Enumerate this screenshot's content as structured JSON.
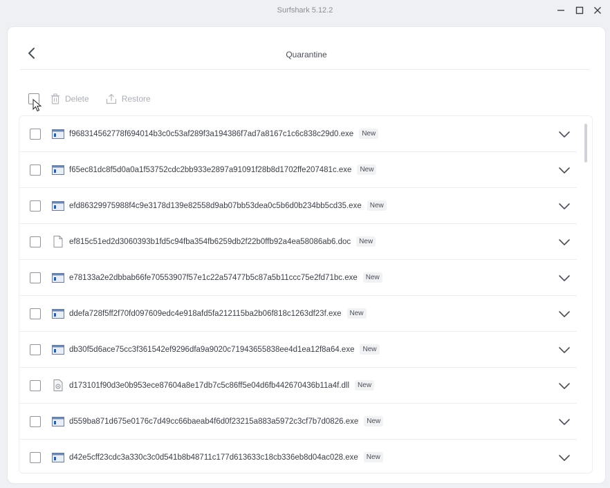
{
  "window": {
    "title": "Surfshark 5.12.2",
    "controls": [
      "minimize-icon",
      "maximize-icon",
      "close-icon"
    ]
  },
  "page": {
    "title": "Quarantine",
    "back_icon": "chevron-left-icon"
  },
  "toolbar": {
    "delete_label": "Delete",
    "delete_icon": "trash-icon",
    "restore_label": "Restore",
    "restore_icon": "upload-icon"
  },
  "files": [
    {
      "name": "f968314562778f694014b3c0c53af289f3a194386f7ad7a8167c1c6c838c29d0.exe",
      "badge": "New",
      "type": "exe"
    },
    {
      "name": "f65ec81dc8f5d0a0a1f53752cdc2bb933e2897a91091f28b8d1702ffe207481c.exe",
      "badge": "New",
      "type": "exe"
    },
    {
      "name": "efd86329975988f4c9e3178d139e82558d9ab07bb53dea0c5b6d0b234bb5cd35.exe",
      "badge": "New",
      "type": "exe"
    },
    {
      "name": "ef815c51ed2d3060393b1fd5c94fba354fb6259db2f22b0ffb92a4ea58086ab6.doc",
      "badge": "New",
      "type": "doc"
    },
    {
      "name": "e78133a2e2dbbab66fe70553907f57e1c22a57477b5c87a5b11ccc75e2fd71bc.exe",
      "badge": "New",
      "type": "exe"
    },
    {
      "name": "ddefa728f5ff2f70fd097609edc4e918afd5fa212115ba2b06f818c1263df23f.exe",
      "badge": "New",
      "type": "exe"
    },
    {
      "name": "db30f5d6ace75cc3f361542ef9296dfa9a9020c71943655838ee4d1ea12f8a64.exe",
      "badge": "New",
      "type": "exe"
    },
    {
      "name": "d173101f90d3e0b953ece87604a8e17db7c5c86ff5e04d6fb442670436b11a4f.dll",
      "badge": "New",
      "type": "dll"
    },
    {
      "name": "d559ba871d675e0176c7d49cc66baeab4f6d0f23215a883a5972c3cf7b7d0826.exe",
      "badge": "New",
      "type": "exe"
    },
    {
      "name": "d42e5cff23cdc3a330c3c0d541b8b48711c177d613633c18cb336eb8d04ac028.exe",
      "badge": "New",
      "type": "exe"
    }
  ],
  "colors": {
    "accent": "#1f5fbf",
    "background": "#eef0f3",
    "card": "#ffffff",
    "muted_text": "#a9adb4"
  }
}
